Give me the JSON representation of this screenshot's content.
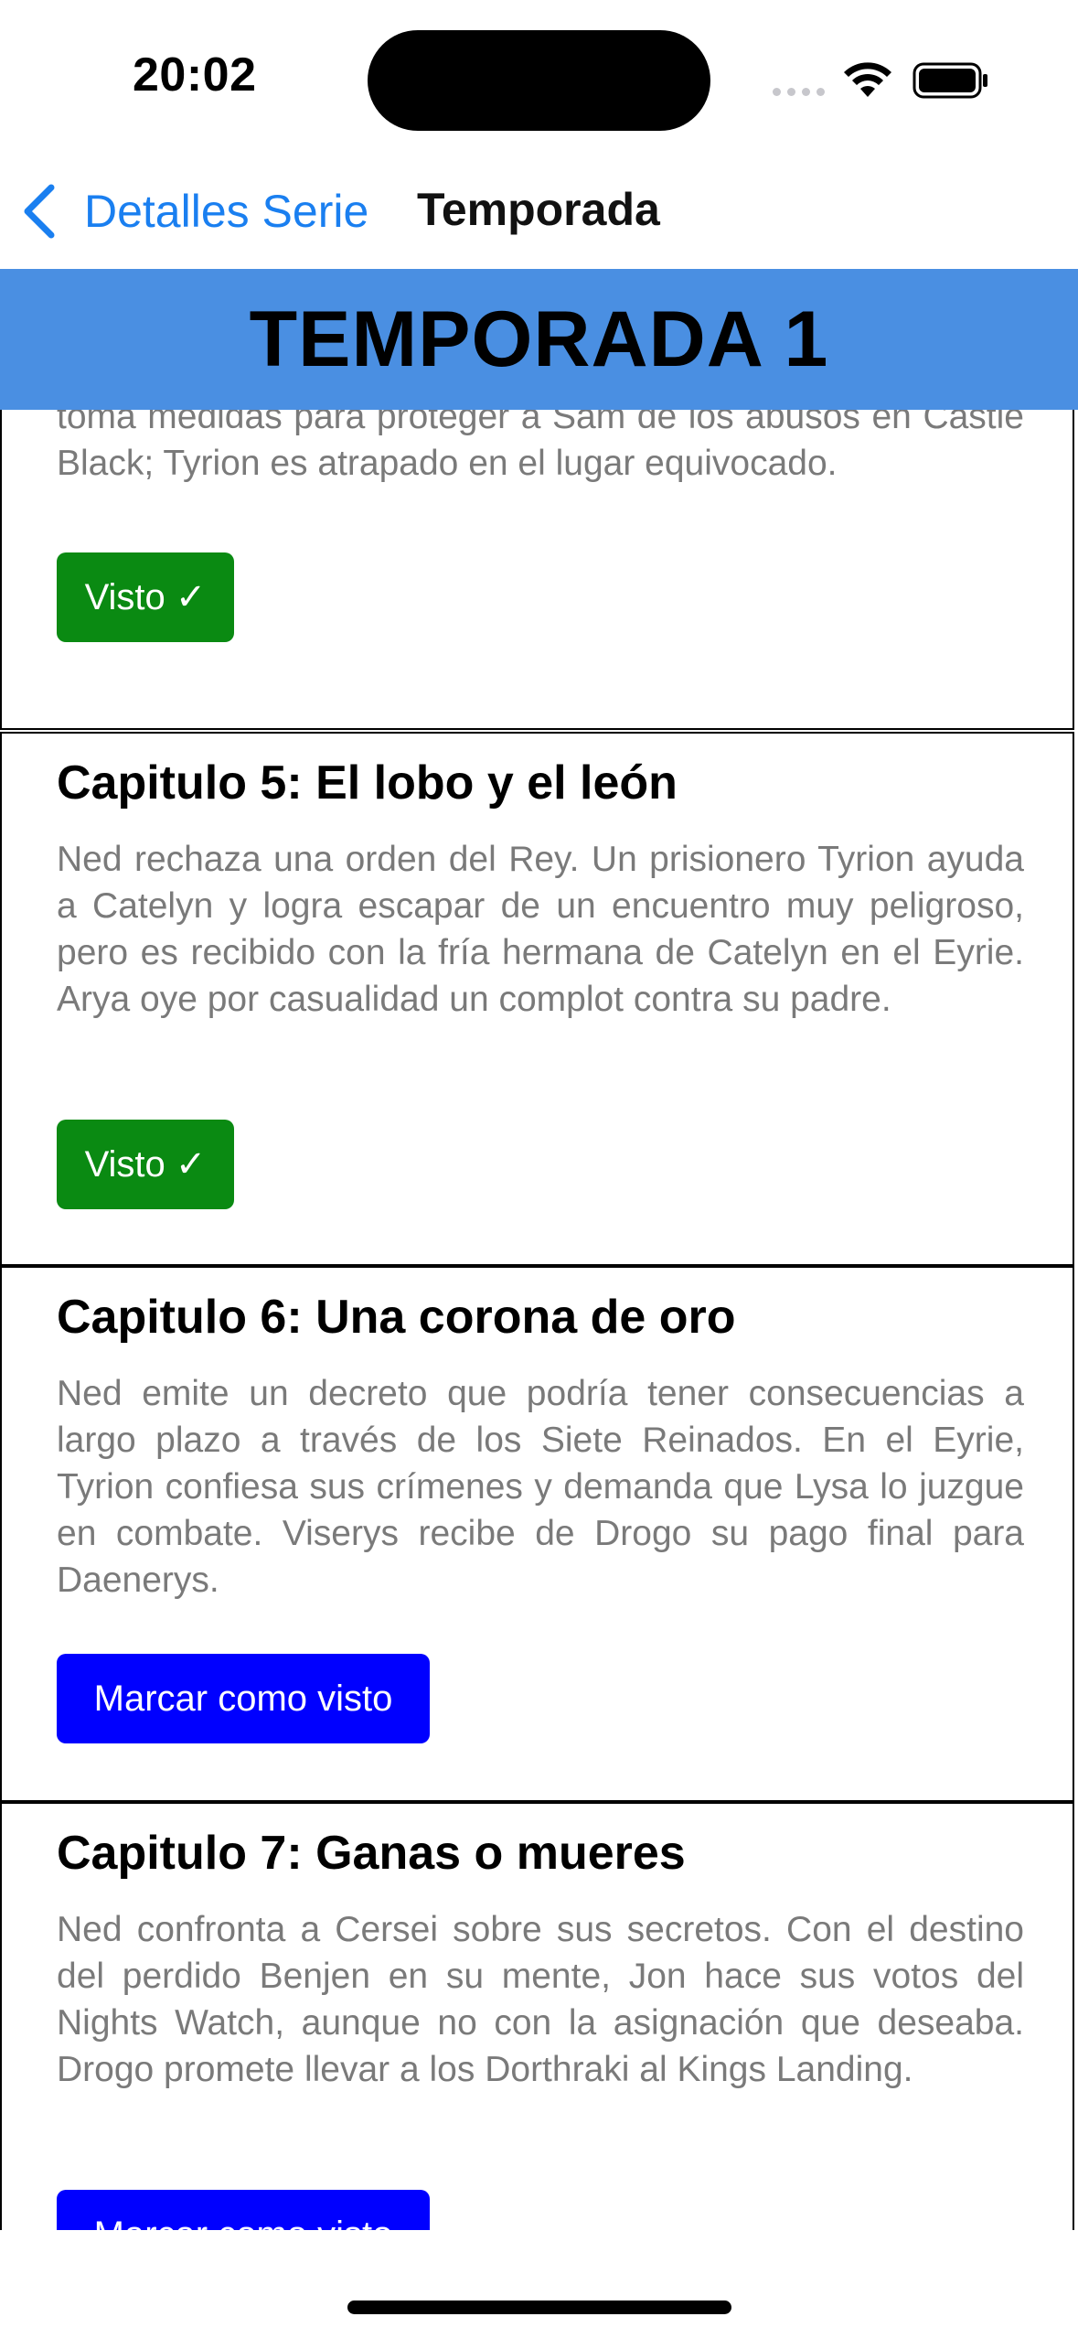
{
  "status_bar": {
    "time": "20:02",
    "signal_icon": "signal-dots-icon",
    "wifi_icon": "wifi-icon",
    "battery_icon": "battery-icon"
  },
  "nav": {
    "back_label": "Detalles Serie",
    "back_icon": "chevron-left-icon",
    "title": "Temporada",
    "accent_color": "#1a7ff0"
  },
  "season": {
    "title": "TEMPORADA 1",
    "header_color": "#4a8fe2"
  },
  "episodes": [
    {
      "title": "",
      "description": "toma medidas para proteger a Sam de los abusos en Castle Black; Tyrion es atrapado en el lugar equivocado.",
      "button_label": "Visto ✓",
      "watched": true
    },
    {
      "title": "Capitulo 5: El lobo y el león",
      "description": "Ned rechaza una orden del Rey. Un prisionero Tyrion ayuda a Catelyn y logra escapar de un encuentro muy peligroso, pero es recibido con la fría hermana de Catelyn en el Eyrie. Arya oye por casualidad un complot contra su padre.",
      "button_label": "Visto ✓",
      "watched": true
    },
    {
      "title": "Capitulo 6: Una corona de oro",
      "description": "Ned emite un decreto que podría tener consecuencias a largo plazo a través de los Siete Reinados. En el Eyrie, Tyrion confiesa sus crímenes y demanda que Lysa lo juzgue en combate. Viserys recibe de Drogo su pago final para Daenerys.",
      "button_label": "Marcar como visto",
      "watched": false
    },
    {
      "title": "Capitulo 7: Ganas o mueres",
      "description": "Ned confronta a Cersei sobre sus secretos. Con el destino del perdido Benjen en su mente, Jon hace sus votos del Nights Watch, aunque no con la asignación que deseaba. Drogo promete llevar a los Dorthraki al Kings Landing.",
      "button_label": "Marcar como visto",
      "watched": false
    }
  ],
  "colors": {
    "watched_button": "#0a8a12",
    "mark_button": "#0000ff"
  }
}
